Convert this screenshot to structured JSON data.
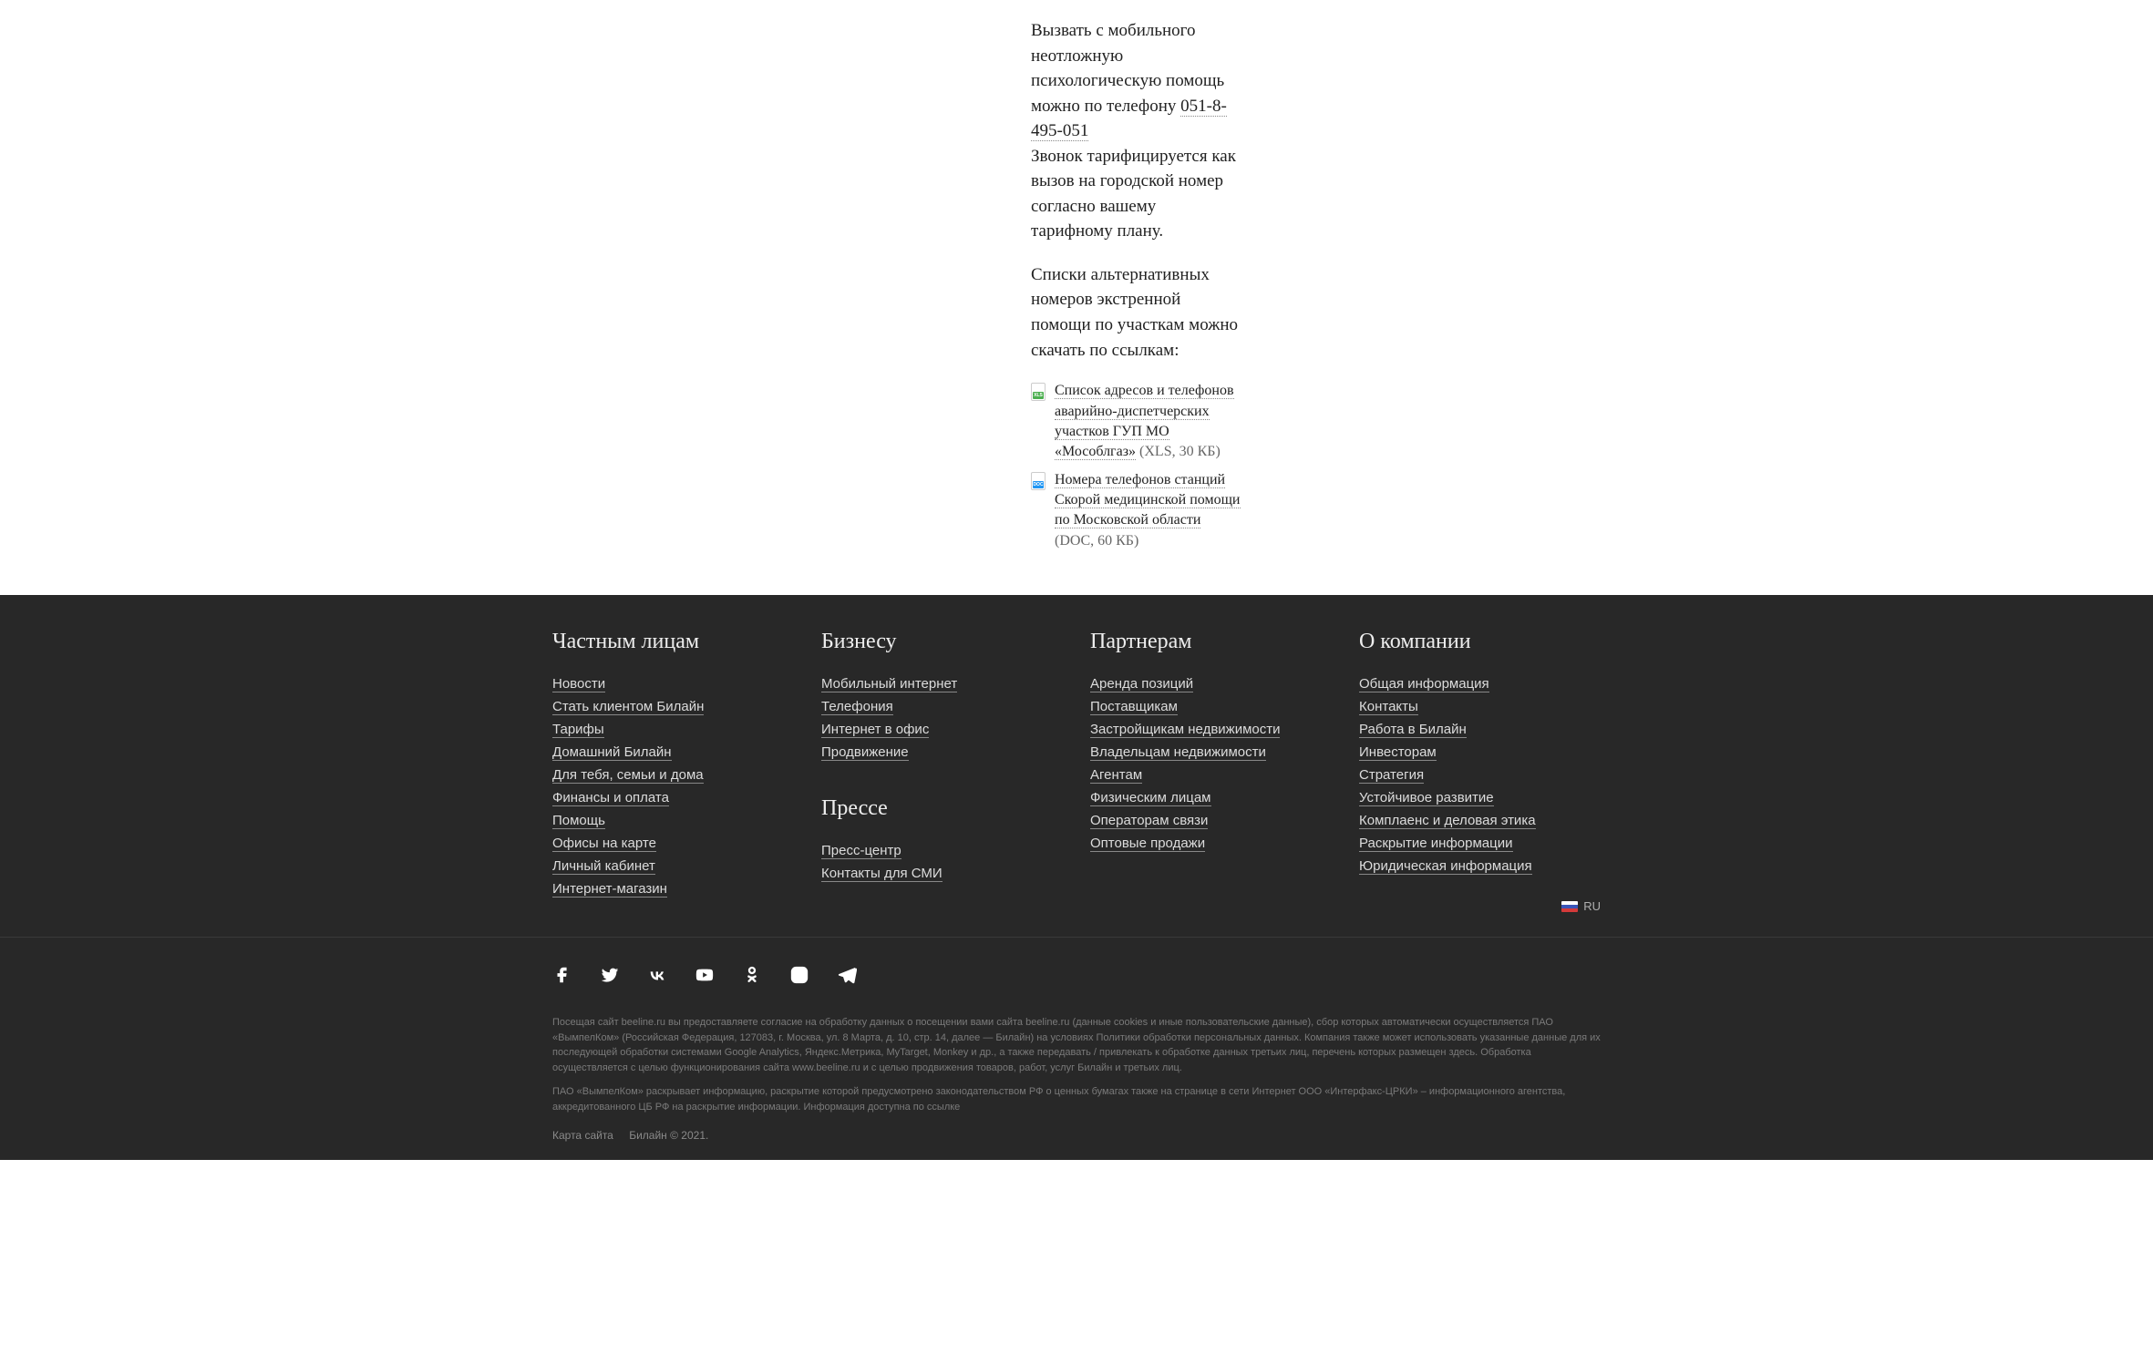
{
  "content": {
    "para1_a": "Вызвать с мобильного неотложную психологическую помощь можно по телефону ",
    "phone": "051-8-495-051",
    "para1_b": "Звонок тарифицируется как вызов на городской номер согласно вашему тарифному плану.",
    "para2": "Списки альтернативных номеров экстренной помощи по участкам можно скачать по ссылкам:",
    "files": [
      {
        "type": "xls",
        "label": "Список адресов и телефонов аварийно-диспетчерских участков ГУП МО «Мособлгаз»",
        "meta": " (XLS, 30 КБ)"
      },
      {
        "type": "doc",
        "label": "Номера телефонов станций Скорой медицинской помощи по Московской области",
        "meta": " (DOC, 60 КБ)"
      }
    ]
  },
  "footer": {
    "col1": {
      "title": "Частным лицам",
      "links": [
        "Новости",
        "Стать клиентом Билайн",
        "Тарифы",
        "Домашний Билайн",
        "Для тебя, семьи и дома",
        "Финансы и оплата",
        "Помощь",
        "Офисы на карте",
        "Личный кабинет",
        "Интернет-магазин"
      ]
    },
    "col2a": {
      "title": "Бизнесу",
      "links": [
        "Мобильный интернет",
        "Телефония",
        "Интернет в офис",
        "Продвижение"
      ]
    },
    "col2b": {
      "title": "Прессе",
      "links": [
        "Пресс-центр",
        "Контакты для СМИ"
      ]
    },
    "col3": {
      "title": "Партнерам",
      "links": [
        "Аренда позиций",
        "Поставщикам",
        "Застройщикам недвижимости",
        "Владельцам недвижимости",
        "Агентам",
        "Физическим лицам",
        "Операторам связи",
        "Оптовые продажи"
      ]
    },
    "col4": {
      "title": "О компании",
      "links": [
        "Общая информация",
        "Контакты",
        "Работа в Билайн",
        "Инвесторам",
        "Стратегия",
        "Устойчивое развитие",
        "Комплаенс и деловая этика",
        "Раскрытие информации",
        "Юридическая информация"
      ]
    },
    "lang": "RU",
    "legal1": "Посещая сайт beeline.ru вы предоставляете согласие на обработку данных о посещении вами сайта beeline.ru (данные cookies и иные пользовательские данные), сбор которых автоматически осуществляется ПАО «ВымпелКом» (Российская Федерация, 127083, г. Москва, ул. 8 Марта, д. 10, стр. 14, далее — Билайн) на условиях Политики обработки персональных данных. Компания также может использовать указанные данные для их последующей обработки системами Google Analytics, Яндекс.Метрика, MyTarget, Monkey и др., а также передавать / привлекать к обработке данных третьих лиц, перечень которых размещен здесь. Обработка осуществляется с целью функционирования сайта www.beeline.ru и с целью продвижения товаров, работ, услуг Билайн и третьих лиц.",
    "legal2": "ПАО «ВымпелКом» раскрывает информацию, раскрытие которой предусмотрено законодательством РФ о ценных бумагах также на странице в сети Интернет ООО «Интерфакс-ЦРКИ» – информационного агентства, аккредитованного ЦБ РФ на раскрытие информации. Информация доступна по ссылке",
    "sitemap": "Карта сайта",
    "copyright": "Билайн © 2021."
  }
}
